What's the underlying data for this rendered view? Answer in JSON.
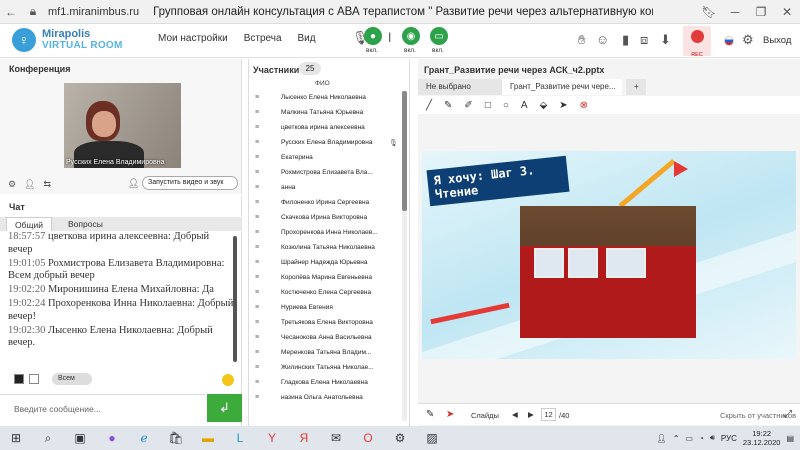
{
  "browser": {
    "url": "mf1.miranimbus.ru",
    "title": "Групповая онлайн консультация с АВА терапистом \" Развитие речи через альтернативную коммуникацию\"...."
  },
  "app": {
    "logo_line1": "Mirapolis",
    "logo_line2": "VIRTUAL ROOM",
    "menu": [
      "Мои настройки",
      "Встреча",
      "Вид"
    ],
    "media": [
      {
        "icon": "microphone-icon",
        "label": "вкл."
      },
      {
        "icon": "camera-icon",
        "label": "вкл."
      },
      {
        "icon": "screen-share-icon",
        "label": "вкл."
      }
    ],
    "rec_label": "REC",
    "exit_label": "Выход",
    "accent_green": "#2ea24b"
  },
  "conference": {
    "header": "Конференция",
    "video_name": "Русских Елена Владимировна",
    "start_video_label": "Запустить видео и звук"
  },
  "chat": {
    "header": "Чат",
    "tabs": [
      "Общий",
      "Вопросы"
    ],
    "messages": [
      {
        "time": "18:57:57",
        "author": "цветкова ирина алексеевна:",
        "text": "Добрый вечер"
      },
      {
        "time": "19:01:05",
        "author": "Рохмистрова Елизавета Владимировна:",
        "text": "Всем добрый вечер"
      },
      {
        "time": "19:02:20",
        "author": "Миронишина Елена Михайловна:",
        "text": "Да"
      },
      {
        "time": "19:02:24",
        "author": "Прохоренкова Инна Николаевна:",
        "text": "Добрый вечер!"
      },
      {
        "time": "19:02:30",
        "author": "Лысенко Елена Николаевна:",
        "text": "Добрый вечер."
      }
    ],
    "recipient": "Всем",
    "input_placeholder": "Введите сообщение..."
  },
  "participants": {
    "header": "Участники",
    "count": "25",
    "column_header": "ФИО",
    "list": [
      "Лысенко Елена Николаевна",
      "Малкина Татьяна Юрьевна",
      "цветкова ирина алексеевна",
      "Русских Елена Владимировна",
      "Екатерина",
      "Рохмистрова Елизавета Вла...",
      "анна",
      "Филоненко Ирина Сергеевна",
      "Скачкова Ирина Викторовна",
      "Прохоренкова Инна Николаев...",
      "Козюлина Татьяна Николаевна",
      "Шрайнер Надежда Юрьевна",
      "Королёва Марина Евгеньевна",
      "Костюченко Елена Сергеевна",
      "Нуриева Евгения",
      "Третьякова Елена Викторовна",
      "Чесанокова Анна Васильевна",
      "Меренкова Татьяна Владим...",
      "Жилинских Татьяна Николае...",
      "Гладкова Елена Николаевна",
      "назина Ольга Анатольевна"
    ]
  },
  "presentation": {
    "header": "Грант_Развитие речи через АСК_ч2.pptx",
    "tabs": [
      "Не выбрано",
      "Грант_Развитие речи чере...",
      "+"
    ],
    "slide_title": "Я хочу: Шаг 3. Чтение",
    "slides_label": "Слайды",
    "current_page": "12",
    "total_pages": "/40",
    "hide_participants": "Скрыть от участников"
  },
  "taskbar": {
    "lang": "РУС",
    "time": "19:22",
    "date": "23.12.2020"
  }
}
